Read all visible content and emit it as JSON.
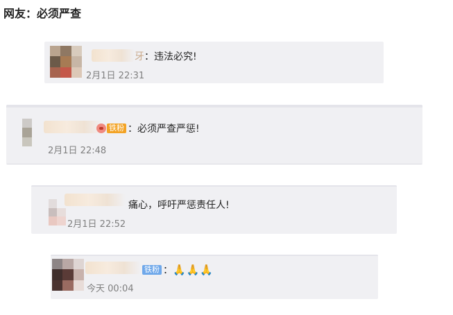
{
  "title": "网友：必须严查",
  "comments": [
    {
      "name_tail": "牙",
      "separator": "：",
      "text": "违法必究!",
      "time": "2月1日 22:31",
      "badge": ""
    },
    {
      "badge": "铁粉",
      "separator": "：",
      "text": "必须严查严惩!",
      "time": "2月1日 22:48"
    },
    {
      "text": "痛心，呼吁严惩责任人!",
      "time": "2月1日 22:52"
    },
    {
      "badge": "铁粉",
      "separator": "：",
      "text": "🙏🙏🙏",
      "time": "今天 00:04"
    }
  ],
  "colors": {
    "card_bg": "#f0f0f3",
    "timestamp": "#7f7f7f",
    "badge_gold": "#f3a324",
    "badge_blue": "#6fa8ea"
  }
}
